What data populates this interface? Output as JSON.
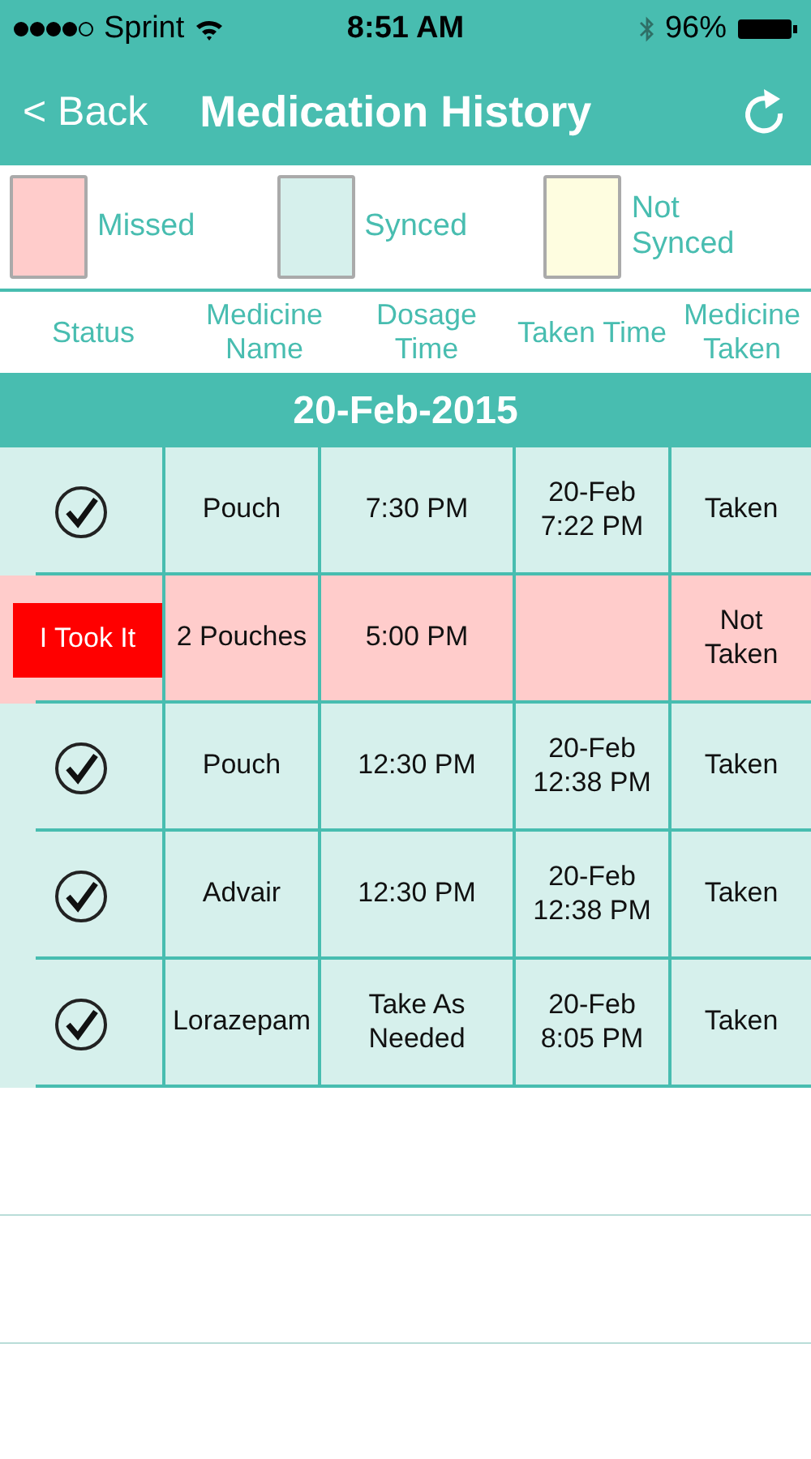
{
  "status_bar": {
    "carrier": "Sprint",
    "time": "8:51 AM",
    "battery": "96%"
  },
  "nav": {
    "back": "< Back",
    "title": "Medication History"
  },
  "legend": [
    {
      "label": "Missed",
      "color": "#ffcccb"
    },
    {
      "label": "Synced",
      "color": "#d6f0ec"
    },
    {
      "label": "Not Synced",
      "color": "#fefde0"
    }
  ],
  "table": {
    "columns": [
      "Status",
      "Medicine Name",
      "Dosage Time",
      "Taken Time",
      "Medicine Taken"
    ],
    "date": "20-Feb-2015",
    "rows": [
      {
        "missed": false,
        "kind": "check",
        "name": "Pouch",
        "dosage": "7:30 PM",
        "taken_time": "20-Feb 7:22 PM",
        "taken": "Taken"
      },
      {
        "missed": true,
        "kind": "button",
        "button": "I Took It",
        "name": "2 Pouches",
        "dosage": "5:00 PM",
        "taken": "Not Taken"
      },
      {
        "missed": false,
        "kind": "check",
        "name": "Pouch",
        "dosage": "12:30 PM",
        "taken_time": "20-Feb 12:38 PM",
        "taken": "Taken"
      },
      {
        "missed": false,
        "kind": "check",
        "name": "Advair",
        "dosage": "12:30 PM",
        "taken_time": "20-Feb 12:38 PM",
        "taken": "Taken"
      },
      {
        "missed": false,
        "kind": "check",
        "name": "Lorazepam",
        "dosage": "Take As Needed",
        "taken_time": "20-Feb 8:05 PM",
        "taken": "Taken"
      }
    ]
  }
}
